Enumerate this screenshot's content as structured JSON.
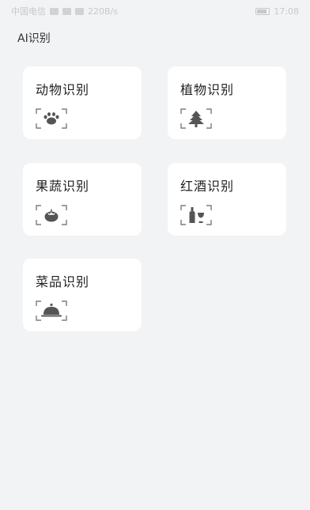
{
  "status_bar": {
    "carrier": "中国电信",
    "speed": "220B/s",
    "time": "17:08"
  },
  "page": {
    "title": "AI识别"
  },
  "cards": [
    {
      "label": "动物识别",
      "icon": "paw-icon"
    },
    {
      "label": "植物识别",
      "icon": "tree-icon"
    },
    {
      "label": "果蔬识别",
      "icon": "tomato-icon"
    },
    {
      "label": "红酒识别",
      "icon": "wine-icon"
    },
    {
      "label": "菜品识别",
      "icon": "dish-icon"
    }
  ],
  "colors": {
    "background": "#f2f3f5",
    "card": "#ffffff",
    "icon": "#555555",
    "frame": "#666666"
  }
}
